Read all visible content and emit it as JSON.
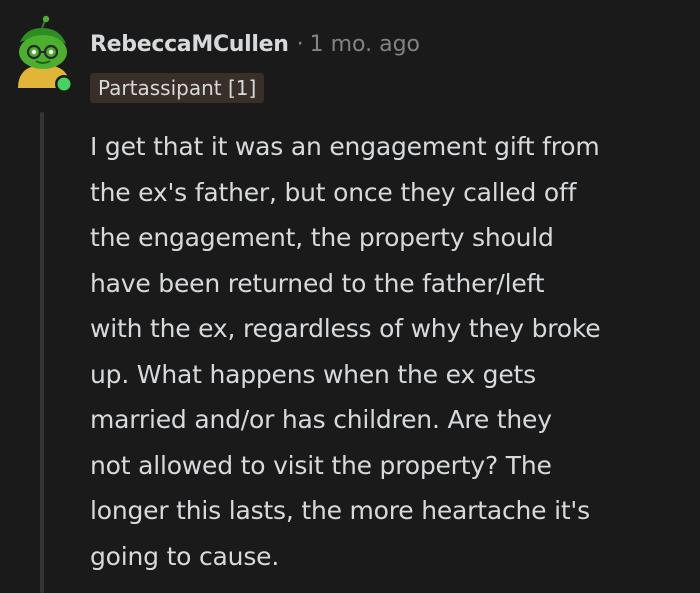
{
  "comment": {
    "username": "RebeccaMCullen",
    "separator": "·",
    "timestamp": "1 mo. ago",
    "flair": "Partassipant [1]",
    "online_status_color": "#46d160",
    "body_lines": [
      "I get that it was an engagement gift from",
      "the ex's father, but once they called off",
      "the engagement, the property should",
      "have been returned to the father/left",
      "with the ex, regardless of why they broke",
      "up. What happens when the ex gets",
      "married and/or has children. Are they",
      "not allowed to visit the property? The",
      "longer this lasts, the more heartache it's",
      "going to cause."
    ]
  },
  "avatar": {
    "icon": "snoo-avatar-icon",
    "color": "#46a832"
  }
}
